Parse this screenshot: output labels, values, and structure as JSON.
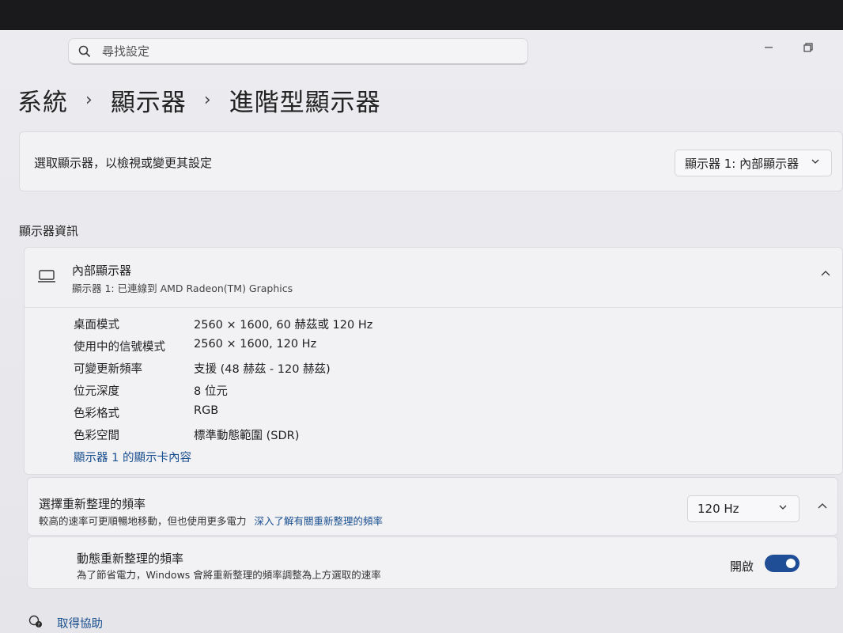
{
  "search": {
    "placeholder": "尋找設定"
  },
  "breadcrumb": {
    "items": [
      "系統",
      "顯示器",
      "進階型顯示器"
    ],
    "separator": "›"
  },
  "select_monitor": {
    "label": "選取顯示器，以檢視或變更其設定",
    "selected": "顯示器 1: 內部顯示器"
  },
  "display_info": {
    "section_title": "顯示器資訊",
    "title": "內部顯示器",
    "subtitle": "顯示器 1: 已連線到 AMD Radeon(TM) Graphics",
    "rows": [
      {
        "key": "桌面模式",
        "value": "2560 × 1600, 60 赫茲或 120 Hz"
      },
      {
        "key": "使用中的信號模式",
        "value": "2560 × 1600, 120 Hz"
      },
      {
        "key": "可變更新頻率",
        "value": "支援 (48 赫茲 - 120 赫茲)"
      },
      {
        "key": "位元深度",
        "value": "8 位元"
      },
      {
        "key": "色彩格式",
        "value": "RGB"
      },
      {
        "key": "色彩空間",
        "value": "標準動態範圍 (SDR)"
      }
    ],
    "adapter_link": "顯示器 1 的顯示卡內容"
  },
  "refresh_rate": {
    "title": "選擇重新整理的頻率",
    "description": "較高的速率可更順暢地移動，但也使用更多電力",
    "learn_more": "深入了解有關重新整理的頻率",
    "selected": "120 Hz"
  },
  "dynamic_refresh": {
    "title": "動態重新整理的頻率",
    "description": "為了節省電力，Windows 會將重新整理的頻率調整為上方選取的速率",
    "state_label": "開啟"
  },
  "help": {
    "label": "取得協助"
  }
}
